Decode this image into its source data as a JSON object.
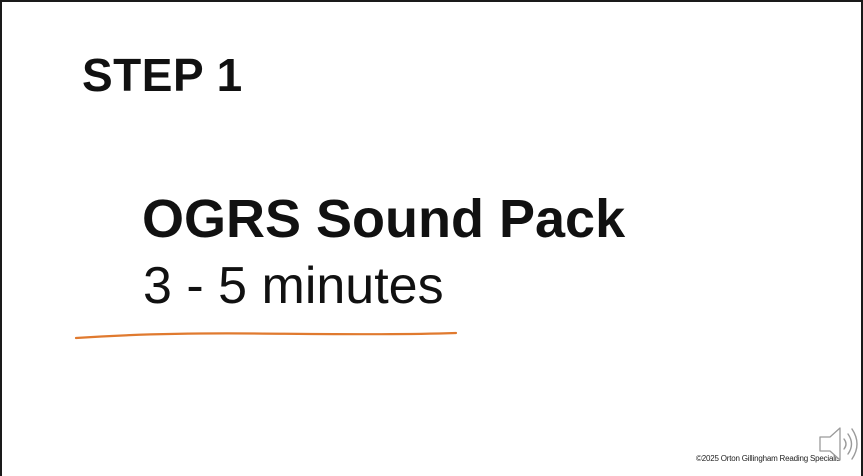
{
  "slide": {
    "step_title": "STEP 1",
    "main_heading": "OGRS Sound Pack",
    "duration": "3 - 5 minutes",
    "copyright": "©2025 Orton Gillingham Reading Specialis",
    "accent_color": "#e07a2f",
    "audio_icon": "speaker-icon"
  }
}
